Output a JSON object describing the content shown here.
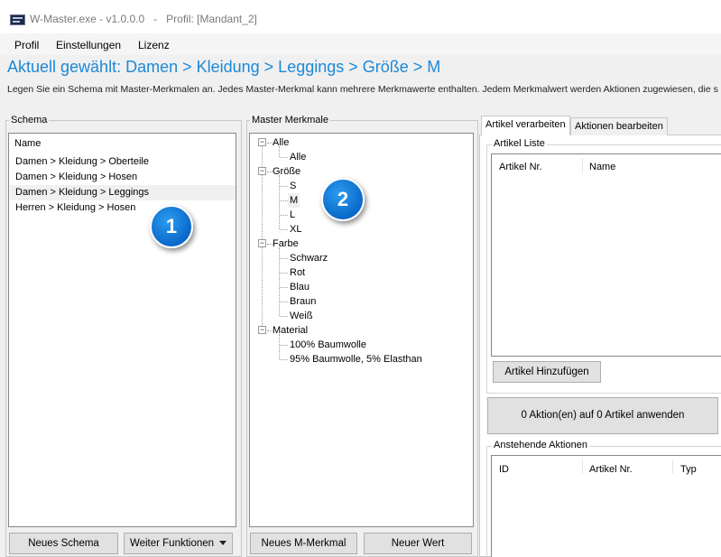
{
  "window": {
    "title": "W-Master.exe - v1.0.0.0   -   Profil: [Mandant_2]",
    "icon": "app-icon"
  },
  "menu": {
    "items": [
      "Profil",
      "Einstellungen",
      "Lizenz"
    ]
  },
  "header": {
    "title": "Aktuell gewählt: Damen > Kleidung > Leggings > Größe > M",
    "description": "Legen Sie ein Schema mit Master-Merkmalen an. Jedes Master-Merkmal kann mehrere Merkmawerte enthalten. Jedem Merkmalwert werden Aktionen zugewiesen, die s",
    "title_color": "#1c88d8"
  },
  "schema": {
    "label": "Schema",
    "column": "Name",
    "rows": [
      "Damen > Kleidung > Oberteile",
      "Damen > Kleidung > Hosen",
      "Damen > Kleidung > Leggings",
      "Herren > Kleidung > Hosen"
    ],
    "selected_index": 2,
    "buttons": {
      "new": "Neues Schema",
      "more": "Weiter Funktionen"
    }
  },
  "master": {
    "label": "Master Merkmale",
    "tree": [
      {
        "label": "Alle",
        "children": [
          "Alle"
        ]
      },
      {
        "label": "Größe",
        "children": [
          "S",
          "M",
          "L",
          "XL"
        ]
      },
      {
        "label": "Farbe",
        "children": [
          "Schwarz",
          "Rot",
          "Blau",
          "Braun",
          "Weiß"
        ]
      },
      {
        "label": "Material",
        "children": [
          "100% Baumwolle",
          "95% Baumwolle, 5% Elasthan"
        ]
      }
    ],
    "selected": "M",
    "buttons": {
      "new_feature": "Neues M-Merkmal",
      "new_value": "Neuer Wert"
    }
  },
  "right": {
    "tabs": [
      "Artikel verarbeiten",
      "Aktionen bearbeiten"
    ],
    "active_tab": 0,
    "article_group": "Artikel Liste",
    "article_columns": [
      "Artikel Nr.",
      "Name"
    ],
    "add_button": "Artikel Hinzufügen",
    "apply_button": "0  Aktion(en) auf 0 Artikel anwenden",
    "pending_group": "Anstehende Aktionen",
    "pending_columns": [
      "ID",
      "Artikel Nr.",
      "Typ"
    ]
  },
  "badges": [
    "1",
    "2"
  ]
}
